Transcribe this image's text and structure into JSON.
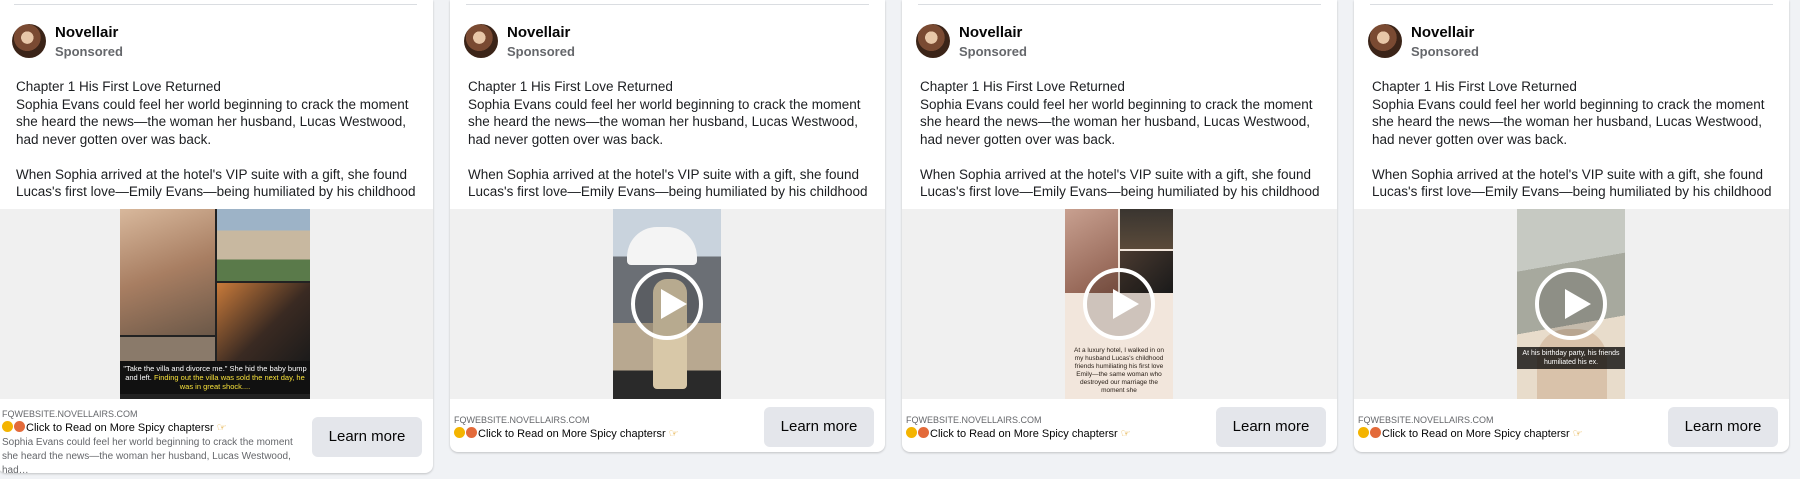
{
  "ads": [
    {
      "page_name": "Novellair",
      "sponsored": "Sponsored",
      "body_lines": [
        "Chapter 1 His First Love Returned",
        "Sophia Evans could feel her world beginning to crack the moment",
        "she heard the news—the woman her husband, Lucas Westwood,",
        "had never gotten over was back.",
        "When Sophia arrived at the hotel's VIP suite with a gift, she found",
        "Lucas's first love—Emily Evans—being humiliated by his childhood …"
      ],
      "media_caption_white": "\"Take the villa and divorce me.\" She hid the baby bump and left.",
      "media_caption_yellow": "Finding out the villa was sold the next day, he was in great shock....",
      "domain": "FQWEBSITE.NOVELLAIRS.COM",
      "headline": "Click to Read on More Spicy chaptersr",
      "description": "Sophia Evans could feel her world beginning to crack the moment she heard the news—the woman her husband, Lucas Westwood, had…",
      "cta": "Learn more"
    },
    {
      "page_name": "Novellair",
      "sponsored": "Sponsored",
      "body_lines": [
        "Chapter 1 His First Love Returned",
        "Sophia Evans could feel her world beginning to crack the moment",
        "she heard the news—the woman her husband, Lucas Westwood,",
        "had never gotten over was back.",
        "When Sophia arrived at the hotel's VIP suite with a gift, she found",
        "Lucas's first love—Emily Evans—being humiliated by his childhood …"
      ],
      "domain": "FQWEBSITE.NOVELLAIRS.COM",
      "headline": "Click to Read on More Spicy chaptersr",
      "cta": "Learn more"
    },
    {
      "page_name": "Novellair",
      "sponsored": "Sponsored",
      "body_lines": [
        "Chapter 1 His First Love Returned",
        "Sophia Evans could feel her world beginning to crack the moment",
        "she heard the news—the woman her husband, Lucas Westwood,",
        "had never gotten over was back.",
        "When Sophia arrived at the hotel's VIP suite with a gift, she found",
        "Lucas's first love—Emily Evans—being humiliated by his childhood …"
      ],
      "media_caption": "At a luxury hotel, I walked in on my husband Lucas's childhood friends humiliating his first love Emily—the same woman who destroyed our marriage the moment she",
      "domain": "FQWEBSITE.NOVELLAIRS.COM",
      "headline": "Click to Read on More Spicy chaptersr",
      "cta": "Learn more"
    },
    {
      "page_name": "Novellair",
      "sponsored": "Sponsored",
      "body_lines": [
        "Chapter 1 His First Love Returned",
        "Sophia Evans could feel her world beginning to crack the moment",
        "she heard the news—the woman her husband, Lucas Westwood,",
        "had never gotten over was back.",
        "When Sophia arrived at the hotel's VIP suite with a gift, she found",
        "Lucas's first love—Emily Evans—being humiliated by his childhood …"
      ],
      "media_caption": "At his birthday party, his friends humiliated his ex.",
      "domain": "FQWEBSITE.NOVELLAIRS.COM",
      "headline": "Click to Read on More Spicy chaptersr",
      "cta": "Learn more"
    }
  ],
  "icons": {
    "avatar": "profile-avatar",
    "play": "play-icon",
    "emoji_1": "smile-emoji-icon",
    "emoji_2": "blush-emoji-icon",
    "hand": "pointing-hand-icon"
  }
}
